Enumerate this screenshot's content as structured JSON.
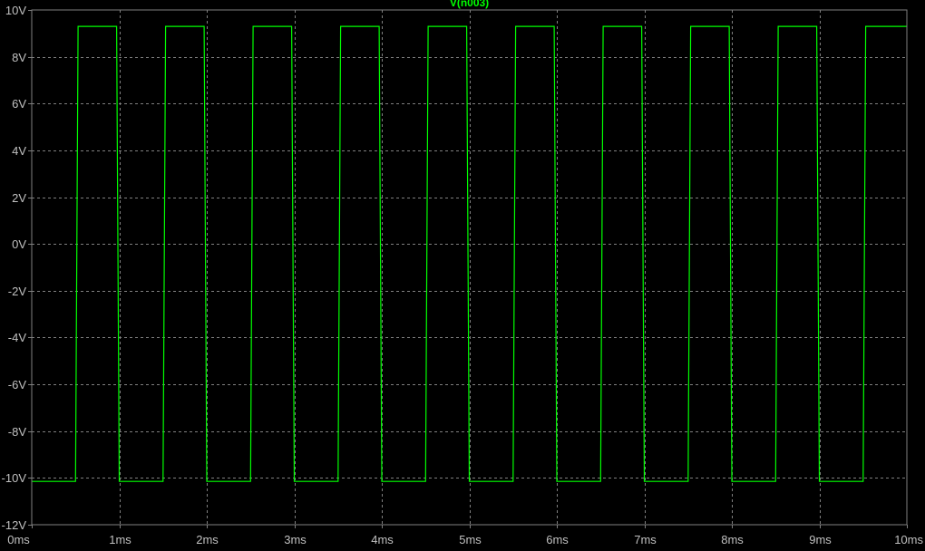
{
  "chart_data": {
    "type": "line",
    "title": "V(n003)",
    "xlabel": "",
    "ylabel": "",
    "xlim": [
      0,
      10
    ],
    "ylim": [
      -12,
      10
    ],
    "x_unit": "ms",
    "y_unit": "V",
    "grid": true,
    "x_ticks": [
      0,
      1,
      2,
      3,
      4,
      5,
      6,
      7,
      8,
      9,
      10
    ],
    "x_tick_labels": [
      "0ms",
      "1ms",
      "2ms",
      "3ms",
      "4ms",
      "5ms",
      "6ms",
      "7ms",
      "8ms",
      "9ms",
      "10ms"
    ],
    "y_ticks": [
      10,
      8,
      6,
      4,
      2,
      0,
      -2,
      -4,
      -6,
      -8,
      -10,
      -12
    ],
    "y_tick_labels": [
      "10V",
      "8V",
      "6V",
      "4V",
      "2V",
      "0V",
      "-2V",
      "-4V",
      "-6V",
      "-8V",
      "-10V",
      "-12V"
    ],
    "series": [
      {
        "name": "V(n003)",
        "color": "#00ff00",
        "x": [
          0,
          0.5,
          0.53,
          0.97,
          1.0,
          1.5,
          1.53,
          1.97,
          2.0,
          2.5,
          2.53,
          2.97,
          3.0,
          3.5,
          3.53,
          3.97,
          4.0,
          4.5,
          4.53,
          4.97,
          5.0,
          5.5,
          5.53,
          5.97,
          6.0,
          6.5,
          6.53,
          6.97,
          7.0,
          7.5,
          7.53,
          7.97,
          8.0,
          8.5,
          8.53,
          8.97,
          9.0,
          9.5,
          9.53,
          10.0
        ],
        "y": [
          -10.15,
          -10.15,
          9.3,
          9.3,
          -10.15,
          -10.15,
          9.3,
          9.3,
          -10.15,
          -10.15,
          9.3,
          9.3,
          -10.15,
          -10.15,
          9.3,
          9.3,
          -10.15,
          -10.15,
          9.3,
          9.3,
          -10.15,
          -10.15,
          9.3,
          9.3,
          -10.15,
          -10.15,
          9.3,
          9.3,
          -10.15,
          -10.15,
          9.3,
          9.3,
          -10.15,
          -10.15,
          9.3,
          9.3,
          -10.15,
          -10.15,
          9.3,
          9.3
        ]
      }
    ]
  },
  "colors": {
    "background": "#000000",
    "frame": "#808080",
    "grid": "#808080",
    "tick_label": "#c0c0c0",
    "trace": "#00ff00"
  }
}
